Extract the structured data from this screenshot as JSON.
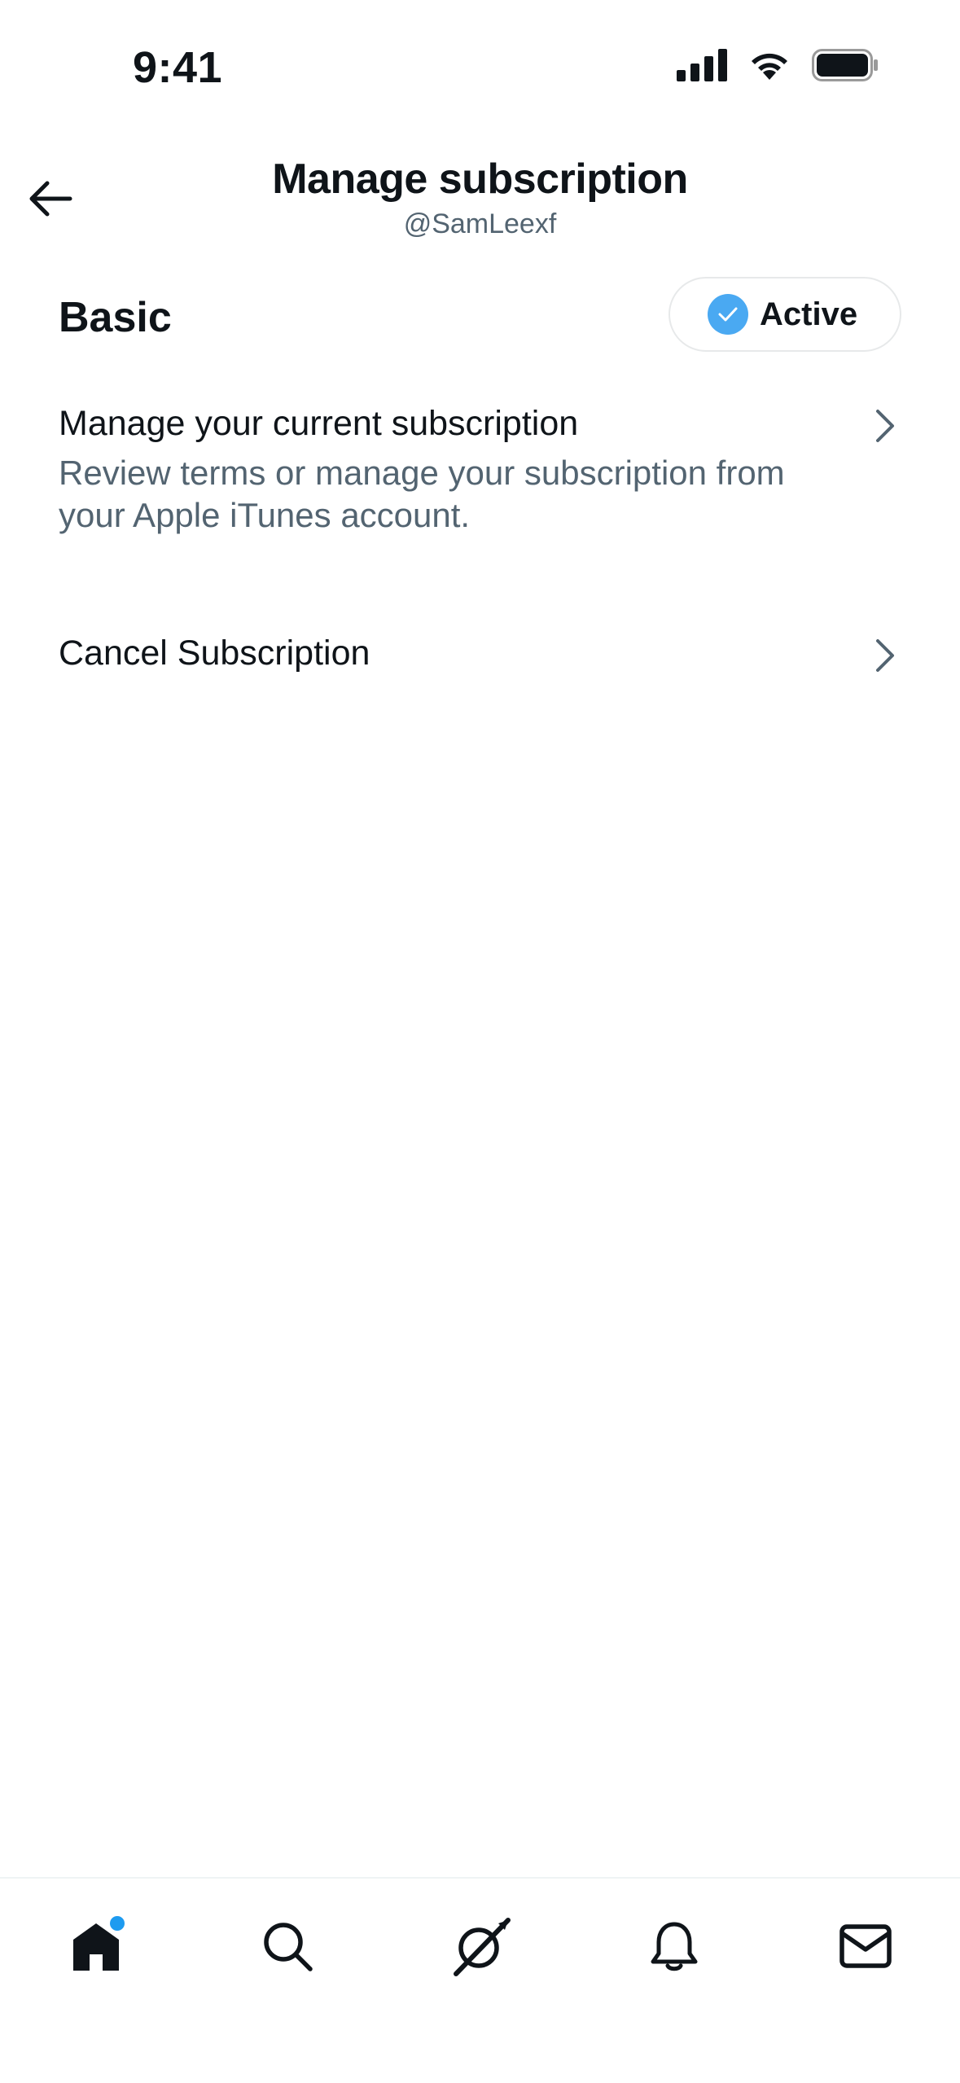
{
  "status_bar": {
    "time": "9:41",
    "icons": [
      "cellular-signal-icon",
      "wifi-icon",
      "battery-icon"
    ]
  },
  "header": {
    "back_icon": "arrow-left-icon",
    "title": "Manage subscription",
    "subtitle": "@SamLeexf"
  },
  "plan": {
    "name": "Basic",
    "status_label": "Active",
    "status_icon": "check-circle-icon"
  },
  "items": [
    {
      "title": "Manage your current subscription",
      "description": "Review terms or manage your subscription from your Apple iTunes account."
    },
    {
      "title": "Cancel Subscription"
    }
  ],
  "tab_bar": {
    "tabs": [
      "home-icon",
      "search-icon",
      "grok-icon",
      "notifications-bell-icon",
      "messages-mail-icon"
    ]
  },
  "colors": {
    "text_primary": "#0f1419",
    "text_secondary": "#536471",
    "accent_blue": "#1d9bf0",
    "check_blue": "#4aa9f2",
    "border": "#e7e9ea"
  }
}
